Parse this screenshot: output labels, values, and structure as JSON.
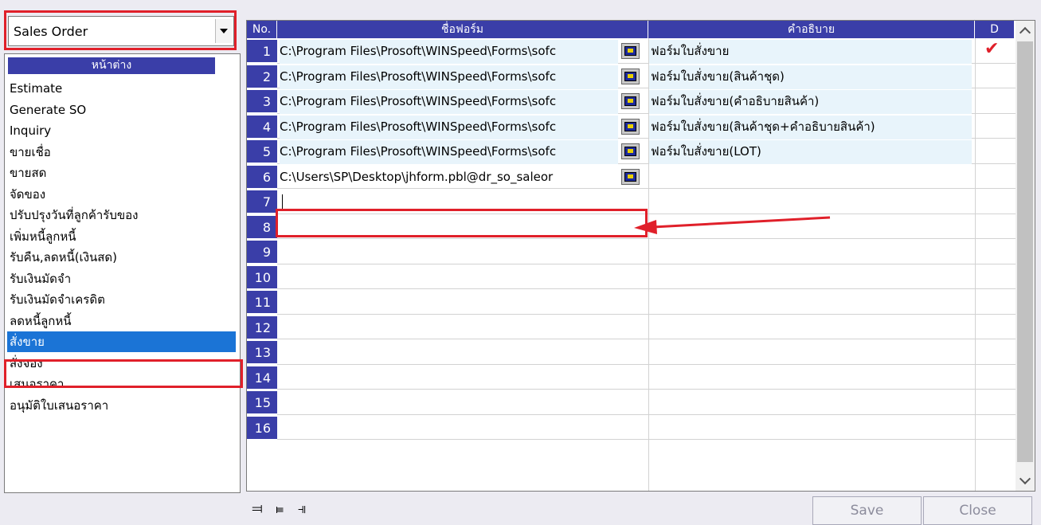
{
  "document_type": {
    "selected": "Sales Order"
  },
  "window_list": {
    "header": "หน้าต่าง",
    "items": [
      "Estimate",
      "Generate SO",
      "Inquiry",
      "ขายเชื่อ",
      "ขายสด",
      "จัดของ",
      "ปรับปรุงวันที่ลูกค้ารับของ",
      "เพิ่มหนี้ลูกหนี้",
      "รับคืน,ลดหนี้(เงินสด)",
      "รับเงินมัดจำ",
      "รับเงินมัดจำเครดิต",
      "ลดหนี้ลูกหนี้",
      "สั่งขาย",
      "สั่งจอง",
      "เสนอราคา",
      "อนุมัติใบเสนอราคา"
    ],
    "selected_index": 12
  },
  "grid": {
    "columns": {
      "no": "No.",
      "form_name": "ชื่อฟอร์ม",
      "description": "คำอธิบาย",
      "default": "D"
    },
    "rows": [
      {
        "no": "1",
        "form": "C:\\Program Files\\Prosoft\\WINSpeed\\Forms\\sofc",
        "desc": "ฟอร์มใบสั่งขาย",
        "default": true
      },
      {
        "no": "2",
        "form": "C:\\Program Files\\Prosoft\\WINSpeed\\Forms\\sofc",
        "desc": "ฟอร์มใบสั่งขาย(สินค้าชุด)",
        "default": false
      },
      {
        "no": "3",
        "form": "C:\\Program Files\\Prosoft\\WINSpeed\\Forms\\sofc",
        "desc": "ฟอร์มใบสั่งขาย(คำอธิบายสินค้า)",
        "default": false
      },
      {
        "no": "4",
        "form": "C:\\Program Files\\Prosoft\\WINSpeed\\Forms\\sofc",
        "desc": "ฟอร์มใบสั่งขาย(สินค้าชุด+คำอธิบายสินค้า)",
        "default": false
      },
      {
        "no": "5",
        "form": "C:\\Program Files\\Prosoft\\WINSpeed\\Forms\\sofc",
        "desc": "ฟอร์มใบสั่งขาย(LOT)",
        "default": false
      },
      {
        "no": "6",
        "form": "C:\\Users\\SP\\Desktop\\jhform.pbl@dr_so_saleor",
        "desc": "",
        "default": false
      },
      {
        "no": "7",
        "form": "",
        "desc": "",
        "default": false
      },
      {
        "no": "8",
        "form": "",
        "desc": "",
        "default": false
      },
      {
        "no": "9",
        "form": "",
        "desc": "",
        "default": false
      },
      {
        "no": "10",
        "form": "",
        "desc": "",
        "default": false
      },
      {
        "no": "11",
        "form": "",
        "desc": "",
        "default": false
      },
      {
        "no": "12",
        "form": "",
        "desc": "",
        "default": false
      },
      {
        "no": "13",
        "form": "",
        "desc": "",
        "default": false
      },
      {
        "no": "14",
        "form": "",
        "desc": "",
        "default": false
      },
      {
        "no": "15",
        "form": "",
        "desc": "",
        "default": false
      },
      {
        "no": "16",
        "form": "",
        "desc": "",
        "default": false
      }
    ],
    "check_glyph": "✔"
  },
  "toolbar": {
    "icons": [
      "append-row-icon",
      "insert-row-icon",
      "delete-row-icon"
    ]
  },
  "buttons": {
    "save": "Save",
    "close": "Close"
  },
  "colors": {
    "header_blue": "#3a3ea8",
    "selection_blue": "#1b74d6",
    "highlight_red": "#e0202a",
    "filled_row": "#e8f4fb"
  }
}
